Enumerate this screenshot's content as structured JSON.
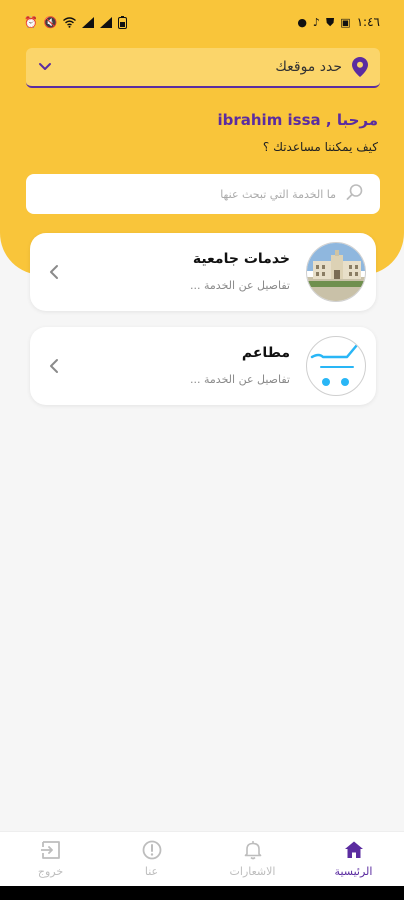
{
  "status_bar": {
    "time": "١:٤٦",
    "left_icons": [
      "alarm-icon",
      "mute-icon",
      "wifi-icon",
      "signal-icon",
      "signal-icon"
    ],
    "right_icons": [
      "gallery-icon",
      "shield-icon",
      "tiktok-icon",
      "dot-icon"
    ]
  },
  "location": {
    "label": "حدد موقعك"
  },
  "greeting": {
    "text": "مرحبا , ibrahim issa",
    "subtitle": "كيف يمكننا مساعدتك ؟"
  },
  "search": {
    "placeholder": "ما الخدمة التي تبحث عنها"
  },
  "services": [
    {
      "title": "خدمات جامعية",
      "description": "تفاصيل عن الخدمة ...",
      "icon": "university-building-image"
    },
    {
      "title": "مطاعم",
      "description": "تفاصيل عن الخدمة ...",
      "icon": "shopping-cart-icon"
    }
  ],
  "bottom_nav": {
    "items": [
      {
        "label": "الرئيسية",
        "icon": "home-icon",
        "active": true
      },
      {
        "label": "الاشعارات",
        "icon": "bell-icon",
        "active": false
      },
      {
        "label": "عنا",
        "icon": "info-icon",
        "active": false
      },
      {
        "label": "خروج",
        "icon": "logout-icon",
        "active": false
      }
    ]
  },
  "colors": {
    "brand_yellow": "#f9c53a",
    "accent_purple": "#5b2ca0",
    "cart_blue": "#29b6f6",
    "background": "#f6f6f6"
  }
}
